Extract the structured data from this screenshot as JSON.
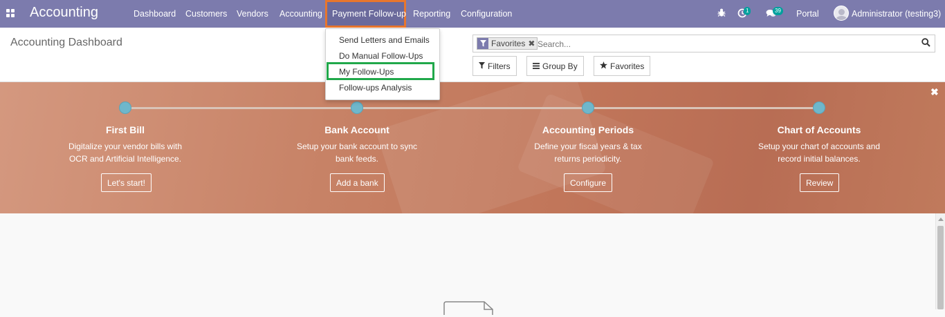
{
  "navbar": {
    "app_title": "Accounting",
    "menu": [
      "Dashboard",
      "Customers",
      "Vendors",
      "Accounting",
      "Payment Follow-up",
      "Reporting",
      "Configuration"
    ],
    "active_menu": "Payment Follow-up",
    "activity_count": "1",
    "message_count": "39",
    "portal_label": "Portal",
    "user_label": "Administrator (testing3)"
  },
  "dropdown": {
    "items": [
      "Send Letters and Emails",
      "Do Manual Follow-Ups",
      "My Follow-Ups",
      "Follow-ups Analysis"
    ],
    "highlighted": "My Follow-Ups"
  },
  "control_panel": {
    "breadcrumb": "Accounting Dashboard",
    "facet_label": "Favorites",
    "search_placeholder": "Search...",
    "filters_label": "Filters",
    "groupby_label": "Group By",
    "favorites_label": "Favorites"
  },
  "banner": {
    "steps": [
      {
        "title": "First Bill",
        "desc_1": "Digitalize your vendor bills with",
        "desc_2": "OCR and Artificial Intelligence.",
        "button": "Let's start!"
      },
      {
        "title": "Bank Account",
        "desc_1": "Setup your bank account to sync",
        "desc_2": "bank feeds.",
        "button": "Add a bank"
      },
      {
        "title": "Accounting Periods",
        "desc_1": "Define your fiscal years & tax",
        "desc_2": "returns periodicity.",
        "button": "Configure"
      },
      {
        "title": "Chart of Accounts",
        "desc_1": "Setup your chart of accounts and",
        "desc_2": "record initial balances.",
        "button": "Review"
      }
    ]
  },
  "colors": {
    "navbar_bg": "#7c7bad",
    "active_outline": "#e8762d",
    "dropdown_highlight": "#20a84a",
    "step_dot": "#6fb7cb",
    "badge": "#00a09d"
  }
}
